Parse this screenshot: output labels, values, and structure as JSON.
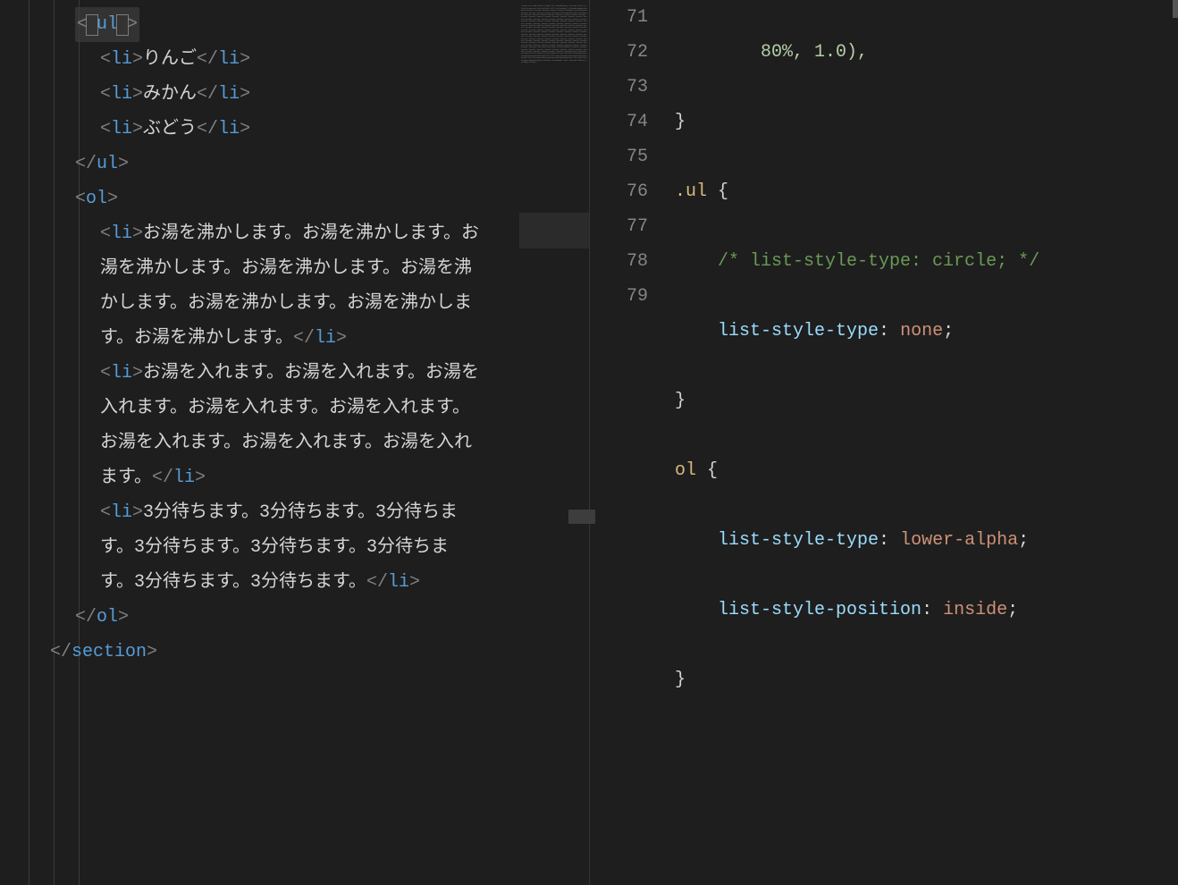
{
  "left_editor": {
    "top_fragment": "80%, 1.0),",
    "ul_open_tag": "ul",
    "ul_items": [
      "りんご",
      "みかん",
      "ぶどう"
    ],
    "ol_items": [
      "お湯を沸かします。お湯を沸かします。お湯を沸かします。お湯を沸かします。お湯を沸かします。お湯を沸かします。お湯を沸かします。お湯を沸かします。",
      "お湯を入れます。お湯を入れます。お湯を入れます。お湯を入れます。お湯を入れます。お湯を入れます。お湯を入れます。お湯を入れます。",
      "3分待ちます。3分待ちます。3分待ちます。3分待ちます。3分待ちます。3分待ちます。3分待ちます。3分待ちます。"
    ],
    "li_tag": "li",
    "ol_tag": "ol",
    "ul_tag": "ul",
    "section_tag": "section"
  },
  "right_editor": {
    "line_numbers": [
      "",
      "71",
      "72",
      "73",
      "74",
      "75",
      "76",
      "77",
      "78",
      "79"
    ],
    "lines": {
      "70": "    80%, 1.0),",
      "71": "}",
      "72_sel": ".ul",
      "72_brace": " {",
      "73_comment": "/* list-style-type: circle; */",
      "74_prop": "list-style-type",
      "74_val": "none",
      "75": "}",
      "76_sel": "ol",
      "76_brace": " {",
      "77_prop": "list-style-type",
      "77_val": "lower-alpha",
      "78_prop": "list-style-position",
      "78_val": "inside",
      "79": "}"
    }
  }
}
